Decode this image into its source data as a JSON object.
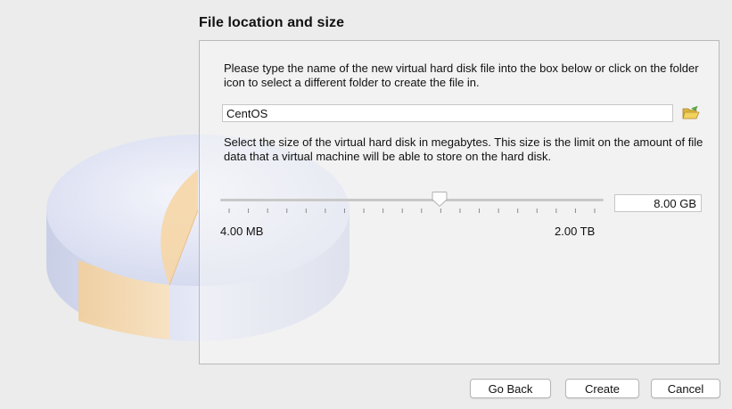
{
  "section": {
    "title": "File location and size"
  },
  "location": {
    "description": "Please type the name of the new virtual hard disk file into the box below or click on the folder icon to select a different folder to create the file in.",
    "file_name": "CentOS",
    "folder_icon": "folder-open-icon"
  },
  "size": {
    "description": "Select the size of the virtual hard disk in megabytes. This size is the limit on the amount of file data that a virtual machine will be able to store on the hard disk.",
    "value": "8.00 GB",
    "min_label": "4.00 MB",
    "max_label": "2.00 TB",
    "slider_fraction": 0.575,
    "tick_count": 20
  },
  "buttons": {
    "back": "Go Back",
    "create": "Create",
    "cancel": "Cancel"
  },
  "illustration": {
    "icon": "hard-disk-pie-icon",
    "disk_color": "#dfe3f3",
    "slice_color": "#f6d6a6"
  }
}
